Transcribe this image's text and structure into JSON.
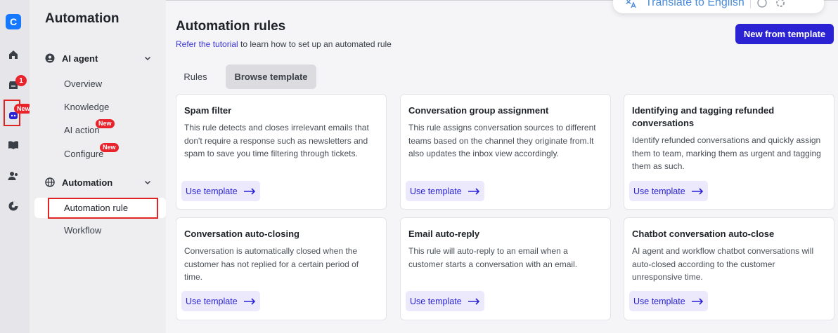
{
  "rail": {
    "logo_letter": "C",
    "inbox_badge": "1",
    "agent_badge": "New",
    "icons": [
      "home-icon",
      "inbox-icon",
      "ai-agent-icon",
      "book-icon",
      "contacts-icon",
      "reports-icon"
    ]
  },
  "sidebar": {
    "title": "Automation",
    "sections": [
      {
        "label": "AI agent",
        "items": [
          {
            "label": "Overview",
            "badge": ""
          },
          {
            "label": "Knowledge",
            "badge": ""
          },
          {
            "label": "AI action",
            "badge": "New"
          },
          {
            "label": "Configure",
            "badge": "New"
          }
        ]
      },
      {
        "label": "Automation",
        "items": [
          {
            "label": "Automation rule",
            "badge": ""
          },
          {
            "label": "Workflow",
            "badge": ""
          }
        ]
      }
    ]
  },
  "translate_bar": {
    "label": "Translate to English"
  },
  "main": {
    "title": "Automation rules",
    "subtitle_link": "Refer the tutorial",
    "subtitle_rest": " to learn how to set up an automated rule",
    "new_button": "New from template",
    "tabs": [
      "Rules",
      "Browse template"
    ],
    "cards": [
      {
        "title": "Spam filter",
        "desc": "This rule detects and closes irrelevant emails that don't require a response such as newsletters and spam to save you time filtering through tickets.",
        "button": "Use template"
      },
      {
        "title": "Conversation group assignment",
        "desc": "This rule assigns conversation sources to different teams based on the channel they originate from.It also updates the inbox view accordingly.",
        "button": "Use template"
      },
      {
        "title": "Identifying and tagging refunded conversations",
        "desc": "Identify refunded conversations and quickly assign them to team, marking them as urgent and tagging them as such.",
        "button": "Use template"
      },
      {
        "title": "Conversation auto-closing",
        "desc": "Conversation is automatically closed when the customer has not replied for a certain period of time.",
        "button": "Use template"
      },
      {
        "title": "Email auto-reply",
        "desc": "This rule will auto-reply to an email when a customer starts a conversation with an email.",
        "button": "Use template"
      },
      {
        "title": "Chatbot conversation auto-close",
        "desc": "AI agent and workflow chatbot conversations will auto-closed according to the customer unresponsive time.",
        "button": "Use template"
      }
    ]
  }
}
